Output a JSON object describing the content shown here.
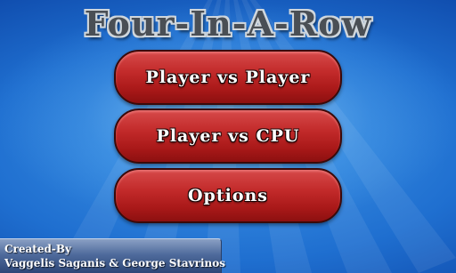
{
  "title": "Four-In-A-Row",
  "menu": {
    "player_vs_player": "Player vs Player",
    "player_vs_cpu": "Player vs CPU",
    "options": "Options"
  },
  "credits": {
    "line1": "Created-By",
    "line2": "Vaggelis Saganis & George Stavrinos"
  },
  "colors": {
    "background_center": "#3f95e6",
    "background_edge": "#093a8f",
    "button_fill": "#c22a2a",
    "button_border": "#3a0a0a",
    "title_fill": "#4a4f55",
    "title_outline": "#cfd6dc",
    "credits_panel": "#4f6b9c"
  }
}
